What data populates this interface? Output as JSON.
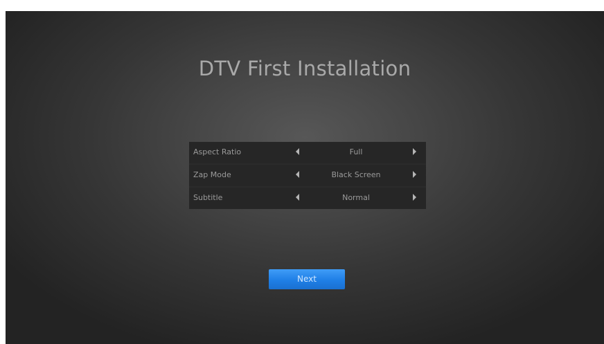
{
  "screen": {
    "title": "DTV First Installation"
  },
  "settings": {
    "rows": [
      {
        "label": "Aspect Ratio",
        "value": "Full"
      },
      {
        "label": "Zap Mode",
        "value": "Black Screen"
      },
      {
        "label": "Subtitle",
        "value": "Normal"
      }
    ]
  },
  "actions": {
    "next_label": "Next"
  },
  "icons": {
    "left": "left-arrow-icon",
    "right": "right-arrow-icon"
  },
  "colors": {
    "accent": "#1f7fe6",
    "text": "#9a9a9a",
    "title": "#a9a9a9"
  }
}
